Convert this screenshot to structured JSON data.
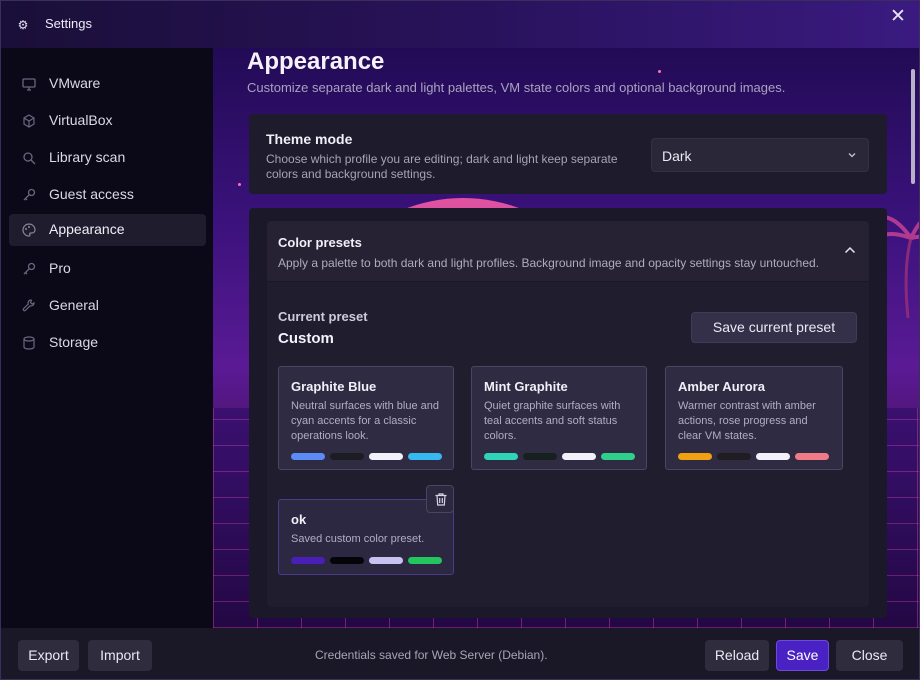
{
  "window": {
    "title": "Settings",
    "app_icon": "gear-icon",
    "close_icon": "close-icon"
  },
  "sidebar": {
    "items": [
      {
        "label": "VMware",
        "icon": "monitor-icon",
        "active": false
      },
      {
        "label": "VirtualBox",
        "icon": "cube-icon",
        "active": false
      },
      {
        "label": "Library scan",
        "icon": "search-icon",
        "active": false
      },
      {
        "label": "Guest access",
        "icon": "key-icon",
        "active": false
      },
      {
        "label": "Appearance",
        "icon": "palette-icon",
        "active": true
      },
      {
        "label": "Pro",
        "icon": "key-icon",
        "active": false
      },
      {
        "label": "General",
        "icon": "wrench-icon",
        "active": false
      },
      {
        "label": "Storage",
        "icon": "database-icon",
        "active": false
      }
    ]
  },
  "page": {
    "title": "Appearance",
    "subtitle": "Customize separate dark and light palettes, VM state colors and optional background images."
  },
  "theme_mode": {
    "title": "Theme mode",
    "description": "Choose which profile you are editing; dark and light keep separate colors and background settings.",
    "selected": "Dark"
  },
  "color_presets": {
    "title": "Color presets",
    "description": "Apply a palette to both dark and light profiles. Background image and opacity settings stay untouched.",
    "current_label": "Current preset",
    "current_value": "Custom",
    "save_button": "Save current preset",
    "presets": [
      {
        "name": "Graphite Blue",
        "description": "Neutral surfaces with blue and cyan accents for a classic operations look.",
        "swatches": [
          "#5b8cf5",
          "#1c1d22",
          "#f2f0f8",
          "#38b8f0"
        ]
      },
      {
        "name": "Mint Graphite",
        "description": "Quiet graphite surfaces with teal accents and soft status colors.",
        "swatches": [
          "#2fd3b8",
          "#16201e",
          "#f2f0f8",
          "#2fd08a"
        ]
      },
      {
        "name": "Amber Aurora",
        "description": "Warmer contrast with amber actions, rose progress and clear VM states.",
        "swatches": [
          "#f0a010",
          "#1f1c22",
          "#f2f0f8",
          "#f07a86"
        ]
      }
    ],
    "custom_presets": [
      {
        "name": "ok",
        "description": "Saved custom color preset.",
        "swatches": [
          "#4a1fb8",
          "#050408",
          "#c8c2f0",
          "#22c55e"
        ]
      }
    ]
  },
  "footer": {
    "export": "Export",
    "import": "Import",
    "status": "Credentials saved for Web Server (Debian).",
    "reload": "Reload",
    "save": "Save",
    "close": "Close"
  },
  "colors": {
    "accent": "#4a22c4",
    "active_nav": "#1f1c2e"
  }
}
